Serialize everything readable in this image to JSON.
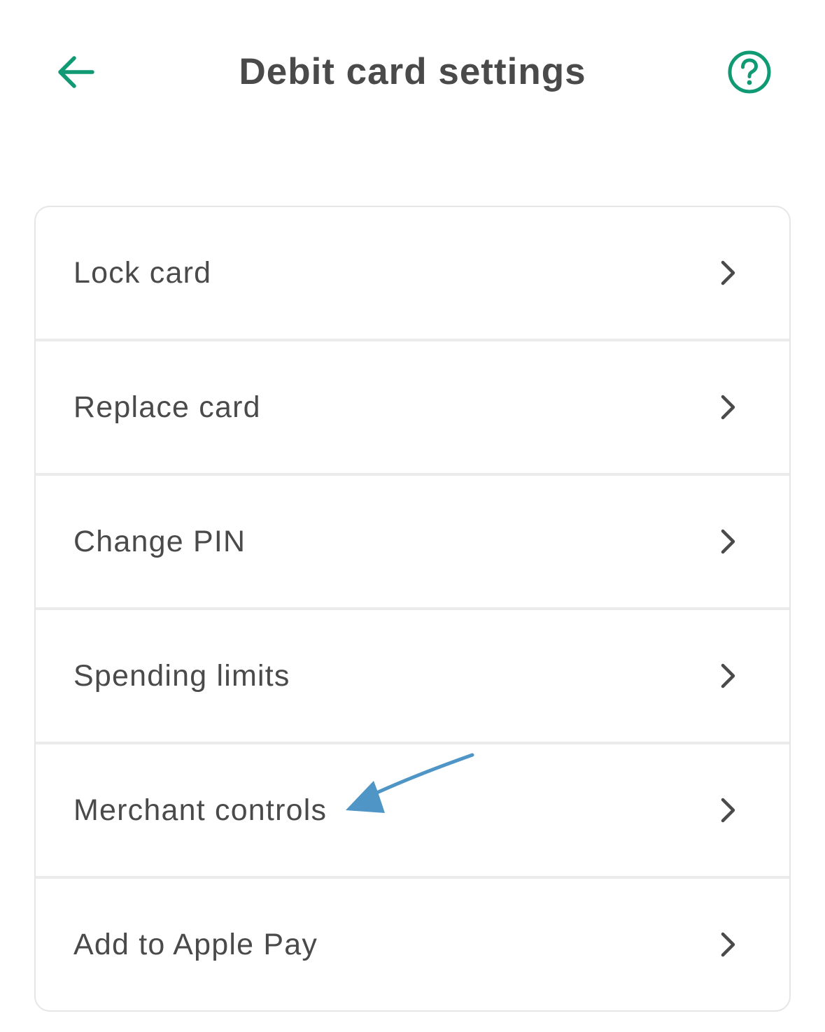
{
  "header": {
    "title": "Debit card settings",
    "back_icon": "arrow-left-icon",
    "help_icon": "question-circle-icon"
  },
  "colors": {
    "accent": "#0f9a74",
    "text": "#4a4a4a",
    "annotation": "#4f95c6"
  },
  "menu": {
    "items": [
      {
        "label": "Lock card",
        "icon": "chevron-right-icon"
      },
      {
        "label": "Replace card",
        "icon": "chevron-right-icon"
      },
      {
        "label": "Change PIN",
        "icon": "chevron-right-icon"
      },
      {
        "label": "Spending limits",
        "icon": "chevron-right-icon"
      },
      {
        "label": "Merchant controls",
        "icon": "chevron-right-icon"
      },
      {
        "label": "Add to Apple Pay",
        "icon": "chevron-right-icon"
      }
    ]
  }
}
